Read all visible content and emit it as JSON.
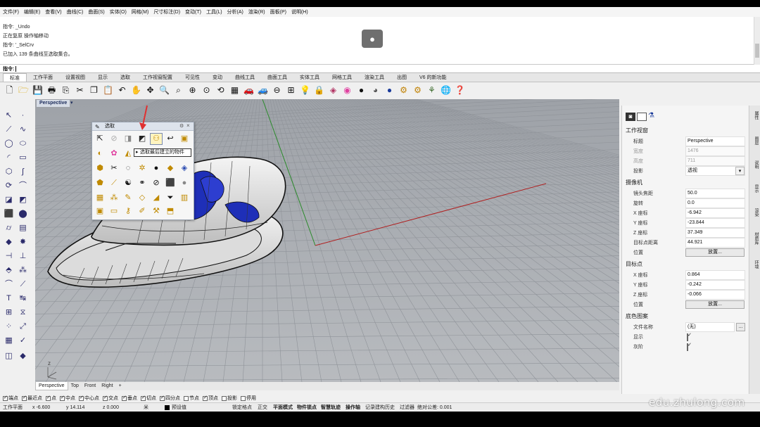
{
  "menu": [
    "文件(F)",
    "编辑(E)",
    "查看(V)",
    "曲线(C)",
    "曲面(S)",
    "实体(O)",
    "网格(M)",
    "尺寸标注(D)",
    "变动(T)",
    "工具(L)",
    "分析(A)",
    "渲染(R)",
    "面板(P)",
    "说明(H)"
  ],
  "history": [
    "指令: _Undo",
    "正在复原 操作轴移动",
    "指令: '_SelCrv",
    "已加入 139 条曲线至选取集合。"
  ],
  "command_prompt": "指令:",
  "ribbon_tabs": [
    "标准",
    "工作平面",
    "设置视图",
    "显示",
    "选取",
    "工作视窗配置",
    "可见性",
    "变动",
    "曲线工具",
    "曲面工具",
    "实体工具",
    "网格工具",
    "渲染工具",
    "出图",
    "V6 的新功能"
  ],
  "viewport": {
    "title": "Perspective",
    "tabs": [
      "Perspective",
      "Top",
      "Front",
      "Right"
    ],
    "add_tab": "+",
    "axis_label": "z"
  },
  "select_panel": {
    "title": "选取",
    "tooltip": "选取最后建立的物件",
    "annotation_color": "#e03131"
  },
  "snaps": [
    {
      "label": "端点",
      "checked": true
    },
    {
      "label": "最近点",
      "checked": true
    },
    {
      "label": "点",
      "checked": true
    },
    {
      "label": "中点",
      "checked": true
    },
    {
      "label": "中心点",
      "checked": true
    },
    {
      "label": "交点",
      "checked": true
    },
    {
      "label": "垂点",
      "checked": true
    },
    {
      "label": "切点",
      "checked": true
    },
    {
      "label": "四分点",
      "checked": true
    },
    {
      "label": "节点",
      "checked": false
    },
    {
      "label": "顶点",
      "checked": true
    },
    {
      "label": "投影",
      "checked": false
    },
    {
      "label": "停用",
      "checked": false
    }
  ],
  "status": {
    "cplane": "工作平面",
    "x": "x -6.600",
    "y": "y 14.114",
    "z": "z 0.000",
    "unit": "米",
    "layer": "预设值",
    "items": [
      "锁定格点",
      "正交",
      "平面模式",
      "物件锁点",
      "智慧轨迹",
      "操作轴",
      "记录建构历史",
      "过滤器",
      "绝对公差: 0.001"
    ]
  },
  "properties": {
    "viewport_section": "工作视窗",
    "title_label": "标题",
    "title_value": "Perspective",
    "width_label": "宽度",
    "width_value": "1476",
    "height_label": "高度",
    "height_value": "711",
    "projection_label": "投影",
    "projection_value": "透视",
    "camera_section": "摄像机",
    "lens_label": "镜头焦距",
    "lens_value": "50.0",
    "rotation_label": "旋转",
    "rotation_value": "0.0",
    "cx_label": "X 座标",
    "cx_value": "-6.942",
    "cy_label": "Y 座标",
    "cy_value": "-23.844",
    "cz_label": "Z 座标",
    "cz_value": "37.349",
    "dist_label": "目标点距离",
    "dist_value": "44.921",
    "pos_label": "位置",
    "place_button": "放置...",
    "target_section": "目标点",
    "tx_label": "X 座标",
    "tx_value": "0.864",
    "ty_label": "Y 座标",
    "ty_value": "-0.242",
    "tz_label": "Z 座标",
    "tz_value": "-0.066",
    "tpos_label": "位置",
    "tplace_button": "放置...",
    "bg_section": "底色图案",
    "file_label": "文件名称",
    "file_value": "(无)",
    "browse_button": "...",
    "show_label": "显示",
    "gray_label": "灰阶"
  },
  "right_tabs": [
    "属性",
    "图层",
    "说明",
    "显示",
    "渲染",
    "材质库",
    "环境"
  ],
  "watermark": "edu.zhulong.com"
}
